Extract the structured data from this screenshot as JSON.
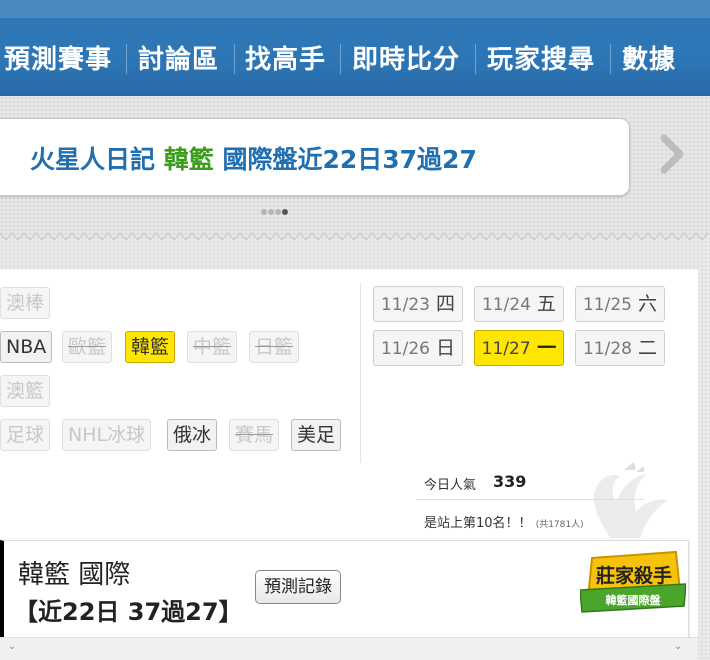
{
  "nav": {
    "items": [
      "預測賽事",
      "討論區",
      "找高手",
      "即時比分",
      "玩家搜尋",
      "數據"
    ]
  },
  "banner": {
    "part1": "火星人日記",
    "part2": "韓籃",
    "part3": "國際盤近22日37過27",
    "pages": 4,
    "active_page": 4
  },
  "sports": [
    "澳棒",
    "NBA",
    "歐籃",
    "韓籃",
    "中籃",
    "日籃",
    "澳籃",
    "足球",
    "NHL冰球",
    "俄冰",
    "賽馬",
    "美足"
  ],
  "selected_sport": "韓籃",
  "dates": [
    {
      "date": "11/23",
      "day": "四"
    },
    {
      "date": "11/24",
      "day": "五"
    },
    {
      "date": "11/25",
      "day": "六"
    },
    {
      "date": "11/26",
      "day": "日"
    },
    {
      "date": "11/27",
      "day": "一"
    },
    {
      "date": "11/28",
      "day": "二"
    }
  ],
  "selected_date": "11/27",
  "popularity": {
    "label": "今日人氣",
    "value": "339",
    "rank_text": "是站上第10名！！",
    "rank_small": "(共1781人)"
  },
  "card": {
    "title": "韓籃 國際",
    "record": "【近22日 37過27】",
    "predict_button": "預測記錄",
    "badge_top": "莊家殺手",
    "badge_bottom": "韓籃國際盤"
  },
  "colors": {
    "nav_bg": "#2d76b6",
    "highlight": "#ffe600",
    "banner_blue": "#1f6fb1",
    "banner_green": "#3c9c1e"
  }
}
